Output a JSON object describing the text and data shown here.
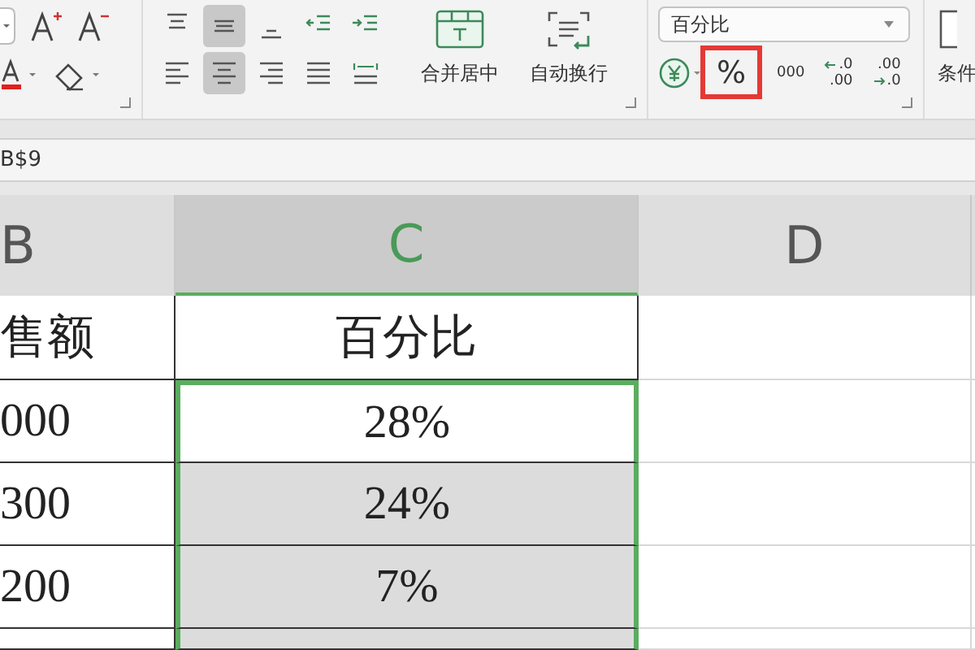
{
  "ribbon": {
    "align_buttons": [
      {
        "kind": "top",
        "selected": false
      },
      {
        "kind": "middle",
        "selected": true
      },
      {
        "kind": "bottom",
        "selected": false
      },
      {
        "kind": "outdent",
        "selected": false
      },
      {
        "kind": "indent",
        "selected": false
      },
      {
        "kind": "left",
        "selected": false
      },
      {
        "kind": "center",
        "selected": true
      },
      {
        "kind": "right",
        "selected": false
      },
      {
        "kind": "justify",
        "selected": false
      },
      {
        "kind": "distribute",
        "selected": false
      }
    ],
    "merge_label": "合并居中",
    "wrap_label": "自动换行",
    "number_format": "百分比",
    "percent_button": {
      "label": "%",
      "highlighted": true
    },
    "thousands_label": "000",
    "increase_decimal": [
      ".0",
      ".00"
    ],
    "decrease_decimal": [
      ".00",
      ".0"
    ],
    "conditional_label": "条件"
  },
  "formula_bar": {
    "text": "B$9"
  },
  "columns": [
    {
      "label": "B",
      "selected": false
    },
    {
      "label": "C",
      "selected": true
    },
    {
      "label": "D",
      "selected": false
    }
  ],
  "rows": [
    {
      "b": "售额",
      "c": "百分比",
      "selected": false,
      "active": false
    },
    {
      "b": "000",
      "c": "28%",
      "selected": true,
      "active": true
    },
    {
      "b": "300",
      "c": "24%",
      "selected": true,
      "active": false
    },
    {
      "b": "200",
      "c": "7%",
      "selected": true,
      "active": false
    },
    {
      "selected": true,
      "active": false
    }
  ]
}
